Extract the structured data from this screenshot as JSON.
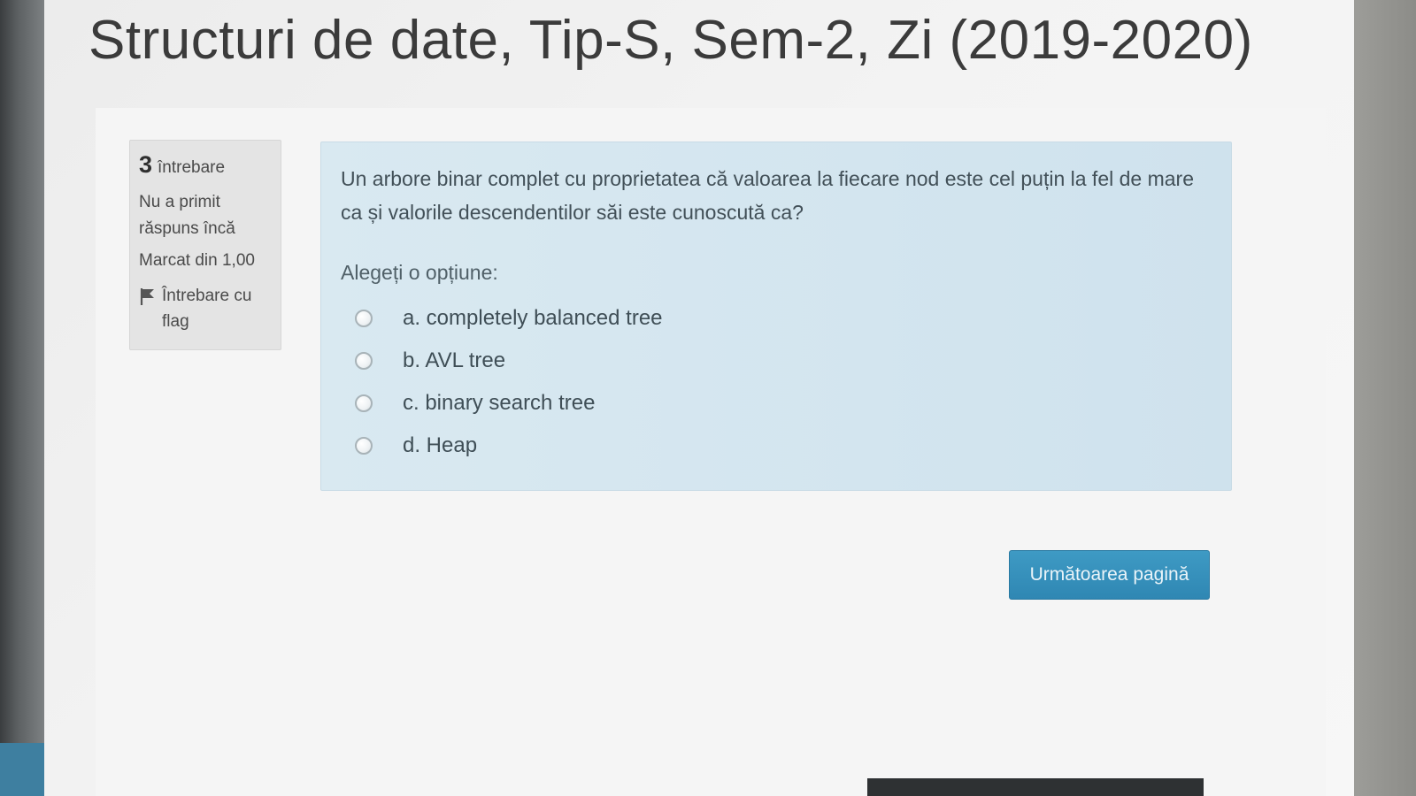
{
  "page": {
    "title": "Structuri de date, Tip-S, Sem-2, Zi (2019-2020)"
  },
  "question_info": {
    "number": "3",
    "label": "întrebare",
    "state": "Nu a primit răspuns încă",
    "grade": "Marcat din 1,00",
    "flag_label": "Întrebare cu flag",
    "flag_icon": "flag-icon"
  },
  "question": {
    "text": "Un arbore binar complet cu proprietatea că valoarea la fiecare nod este cel puțin la fel de mare ca și valorile descendentilor săi este cunoscută ca?",
    "prompt": "Alegeți o opțiune:",
    "options": [
      {
        "label": "a. completely balanced tree",
        "selected": false
      },
      {
        "label": "b. AVL tree",
        "selected": false
      },
      {
        "label": "c. binary search tree",
        "selected": false
      },
      {
        "label": "d. Heap",
        "selected": false
      }
    ]
  },
  "navigation": {
    "next_label": "Următoarea pagină"
  },
  "colors": {
    "accent": "#2f87b3",
    "question_background": "#d6e7f0",
    "info_background": "#e4e4e4"
  }
}
